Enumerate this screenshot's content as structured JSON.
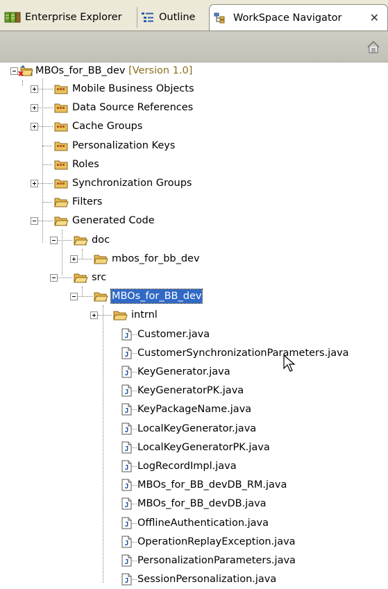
{
  "tabs": [
    {
      "label": "Enterprise Explorer",
      "icon": "enterprise-explorer-icon",
      "active": false
    },
    {
      "label": "Outline",
      "icon": "outline-icon",
      "active": false
    },
    {
      "label": "WorkSpace Navigator",
      "icon": "workspace-navigator-icon",
      "active": true
    }
  ],
  "close_glyph": "✕",
  "toolbar": {
    "home_icon": "home-icon"
  },
  "tree": {
    "root": {
      "label": "MBOs_for_BB_dev",
      "version": "[Version 1.0]",
      "icon": "project-error-icon"
    },
    "items": [
      {
        "label": "Mobile Business Objects",
        "icon": "package-folder-icon",
        "expander": "plus"
      },
      {
        "label": "Data Source References",
        "icon": "package-folder-icon",
        "expander": "plus"
      },
      {
        "label": "Cache Groups",
        "icon": "package-folder-icon",
        "expander": "plus"
      },
      {
        "label": "Personalization Keys",
        "icon": "package-folder-icon",
        "expander": "none"
      },
      {
        "label": "Roles",
        "icon": "package-folder-icon",
        "expander": "none"
      },
      {
        "label": "Synchronization Groups",
        "icon": "package-folder-icon",
        "expander": "plus"
      },
      {
        "label": "Filters",
        "icon": "folder-icon",
        "expander": "none"
      },
      {
        "label": "Generated Code",
        "icon": "folder-open-icon",
        "expander": "minus"
      },
      {
        "label": "doc",
        "icon": "folder-open-icon",
        "expander": "minus"
      },
      {
        "label": "mbos_for_bb_dev",
        "icon": "folder-icon",
        "expander": "plus"
      },
      {
        "label": "src",
        "icon": "folder-open-icon",
        "expander": "minus"
      },
      {
        "label": "MBOs_for_BB_dev",
        "icon": "folder-open-icon",
        "expander": "minus",
        "selected": true
      },
      {
        "label": "intrnl",
        "icon": "folder-icon",
        "expander": "plus"
      },
      {
        "label": "Customer.java",
        "icon": "java-file-icon"
      },
      {
        "label": "CustomerSynchronizationParameters.java",
        "icon": "java-file-icon"
      },
      {
        "label": "KeyGenerator.java",
        "icon": "java-file-icon"
      },
      {
        "label": "KeyGeneratorPK.java",
        "icon": "java-file-icon"
      },
      {
        "label": "KeyPackageName.java",
        "icon": "java-file-icon"
      },
      {
        "label": "LocalKeyGenerator.java",
        "icon": "java-file-icon"
      },
      {
        "label": "LocalKeyGeneratorPK.java",
        "icon": "java-file-icon"
      },
      {
        "label": "LogRecordImpl.java",
        "icon": "java-file-icon"
      },
      {
        "label": "MBOs_for_BB_devDB_RM.java",
        "icon": "java-file-icon"
      },
      {
        "label": "MBOs_for_BB_devDB.java",
        "icon": "java-file-icon"
      },
      {
        "label": "OfflineAuthentication.java",
        "icon": "java-file-icon"
      },
      {
        "label": "OperationReplayException.java",
        "icon": "java-file-icon"
      },
      {
        "label": "PersonalizationParameters.java",
        "icon": "java-file-icon"
      },
      {
        "label": "SessionPersonalization.java",
        "icon": "java-file-icon"
      }
    ]
  },
  "colors": {
    "selection": "#316ac5",
    "version_text": "#8b6d1b",
    "toolbar_bg": "#c9c7bd",
    "tabbar_bg": "#ece9d8"
  }
}
